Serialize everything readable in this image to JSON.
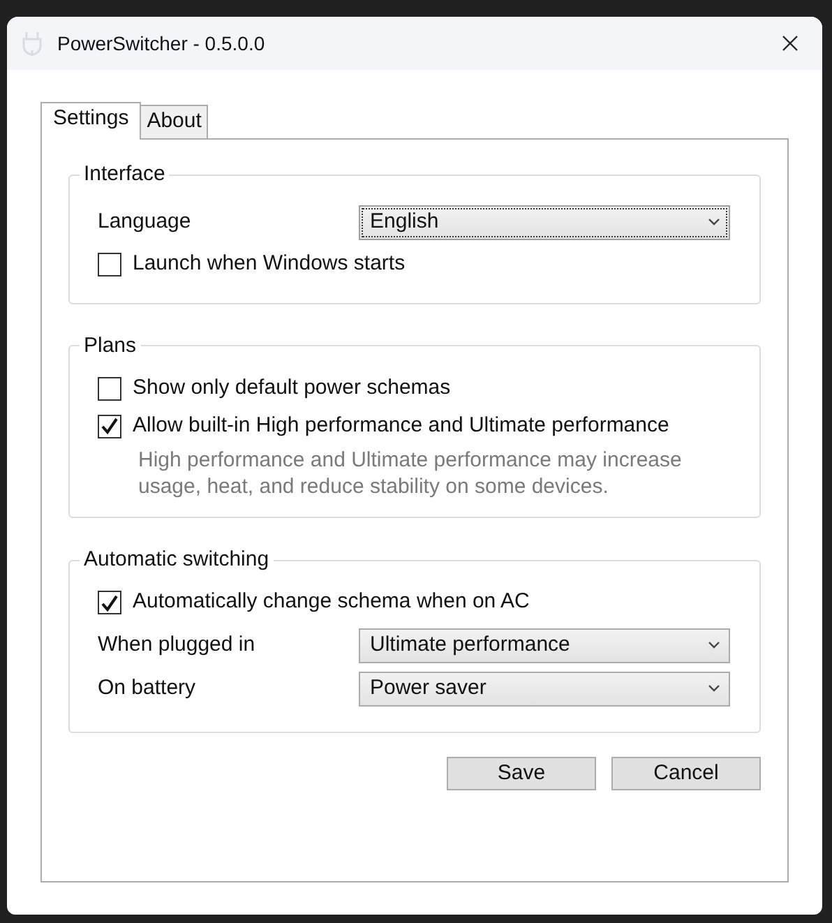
{
  "window": {
    "title": "PowerSwitcher - 0.5.0.0"
  },
  "tabs": [
    {
      "label": "Settings",
      "selected": true
    },
    {
      "label": "About",
      "selected": false
    }
  ],
  "groups": [
    {
      "title": "Interface",
      "rows": [
        {
          "kind": "select",
          "label": "Language",
          "value": "English",
          "focused": true
        },
        {
          "kind": "checkbox",
          "label": "Launch when Windows starts",
          "checked": false
        }
      ]
    },
    {
      "title": "Plans",
      "rows": [
        {
          "kind": "checkbox",
          "label": "Show only default power schemas",
          "checked": false
        },
        {
          "kind": "checkbox",
          "label": "Allow built-in High performance and Ultimate performance",
          "checked": true
        },
        {
          "kind": "note",
          "text": "High performance and Ultimate performance may increase usage, heat, and reduce stability on some devices."
        }
      ]
    },
    {
      "title": "Automatic switching",
      "rows": [
        {
          "kind": "checkbox",
          "label": "Automatically change schema when on AC",
          "checked": true
        },
        {
          "kind": "select",
          "label": "When plugged in",
          "value": "Ultimate performance",
          "focused": false
        },
        {
          "kind": "select",
          "label": "On battery",
          "value": "Power saver",
          "focused": false
        }
      ]
    }
  ],
  "buttons": [
    "Save",
    "Cancel"
  ]
}
